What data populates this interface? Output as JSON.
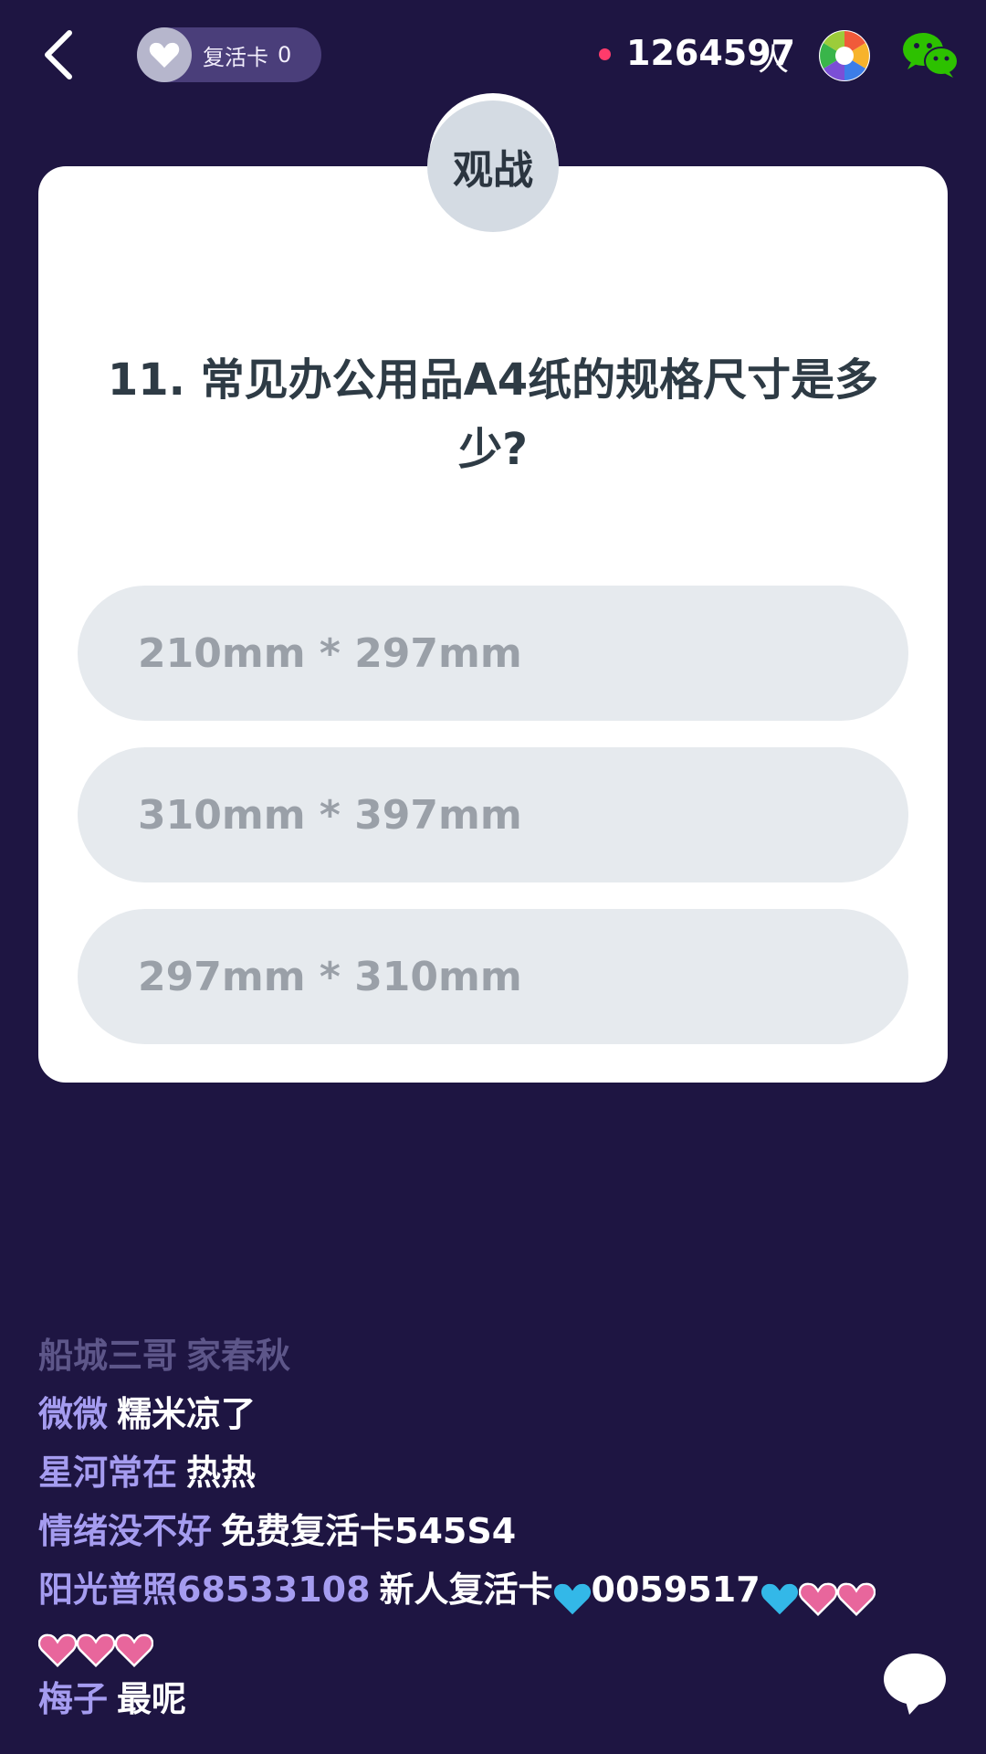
{
  "topbar": {
    "revive_label": "复活卡",
    "revive_count": "0",
    "viewer_count": "1264597",
    "viewer_unit": "人"
  },
  "card": {
    "badge": "观战",
    "question": "11. 常见办公用品A4纸的规格尺寸是多少?",
    "options": [
      "210mm * 297mm",
      "310mm * 397mm",
      "297mm * 310mm"
    ]
  },
  "chat": [
    {
      "user": "船城三哥",
      "msg": "家春秋"
    },
    {
      "user": "微微",
      "msg": "糯米凉了"
    },
    {
      "user": "星河常在",
      "msg": "热热"
    },
    {
      "user": "情绪没不好",
      "msg": "免费复活卡545S4"
    },
    {
      "user": "阳光普照68533108",
      "msg_a": "新人复活卡",
      "msg_b": "0059517"
    },
    {
      "user": "梅子",
      "msg": "最呢"
    }
  ],
  "icons": {
    "back": "chevron-left-icon",
    "revive": "heart-icon",
    "shutter": "camera-shutter-icon",
    "share": "wechat-icon",
    "chat": "chat-bubble-icon"
  },
  "colors": {
    "background": "#1e1542",
    "card": "#ffffff",
    "option": "#e6eaee",
    "username": "#a59cf0",
    "live_dot": "#ff3b6b",
    "cyan_heart": "#33b8e8",
    "pink_heart": "#e8669c"
  }
}
